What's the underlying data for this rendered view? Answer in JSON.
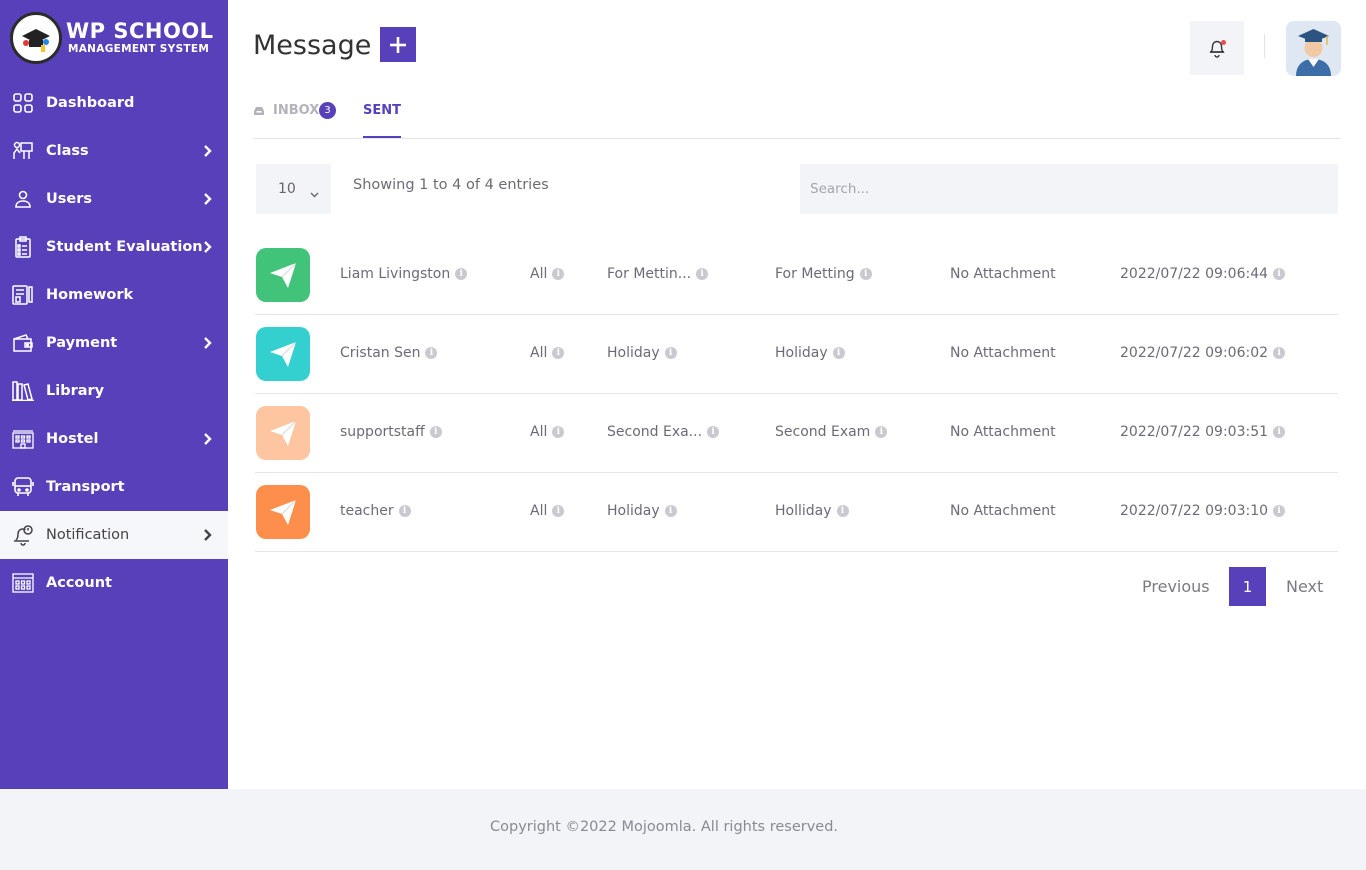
{
  "brand": {
    "title": "WP SCHOOL",
    "subtitle": "MANAGEMENT SYSTEM"
  },
  "sidebar": {
    "items": [
      {
        "label": "Dashboard",
        "icon": "dashboard-icon",
        "has_arrow": false
      },
      {
        "label": "Class",
        "icon": "class-icon",
        "has_arrow": true
      },
      {
        "label": "Users",
        "icon": "user-icon",
        "has_arrow": true
      },
      {
        "label": "Student Evaluation",
        "icon": "evaluation-icon",
        "has_arrow": true
      },
      {
        "label": "Homework",
        "icon": "homework-icon",
        "has_arrow": false
      },
      {
        "label": "Payment",
        "icon": "wallet-icon",
        "has_arrow": true
      },
      {
        "label": "Library",
        "icon": "library-icon",
        "has_arrow": false
      },
      {
        "label": "Hostel",
        "icon": "hostel-icon",
        "has_arrow": true
      },
      {
        "label": "Transport",
        "icon": "bus-icon",
        "has_arrow": false
      },
      {
        "label": "Notification",
        "icon": "notification-bell-icon",
        "has_arrow": true,
        "active": true
      },
      {
        "label": "Account",
        "icon": "account-icon",
        "has_arrow": false
      }
    ]
  },
  "header": {
    "title": "Message",
    "add_label": "+"
  },
  "tabs": {
    "inbox": "INBOX",
    "inbox_count": "3",
    "sent": "SENT"
  },
  "controls": {
    "page_size": "10",
    "showing": "Showing 1 to 4 of 4 entries",
    "search_placeholder": "Search..."
  },
  "rows": [
    {
      "name": "Liam Livingston",
      "to": "All",
      "subject": "For Mettin...",
      "description": "For Metting",
      "attachment": "No Attachment",
      "date": "2022/07/22 09:06:44",
      "color": "#41c479"
    },
    {
      "name": "Cristan Sen",
      "to": "All",
      "subject": "Holiday",
      "description": "Holiday",
      "attachment": "No Attachment",
      "date": "2022/07/22 09:06:02",
      "color": "#34d0d0"
    },
    {
      "name": "supportstaff",
      "to": "All",
      "subject": "Second Exa...",
      "description": "Second Exam",
      "attachment": "No Attachment",
      "date": "2022/07/22 09:03:51",
      "color": "#fdc5a0"
    },
    {
      "name": "teacher",
      "to": "All",
      "subject": "Holiday",
      "description": "Holliday",
      "attachment": "No Attachment",
      "date": "2022/07/22 09:03:10",
      "color": "#fd8e4c"
    }
  ],
  "pagination": {
    "previous": "Previous",
    "current": "1",
    "next": "Next"
  },
  "footer": {
    "copyright": "Copyright ©2022 Mojoomla. All rights reserved."
  },
  "colors": {
    "primary": "#5840bb",
    "background_alt": "#f2f4f8"
  }
}
